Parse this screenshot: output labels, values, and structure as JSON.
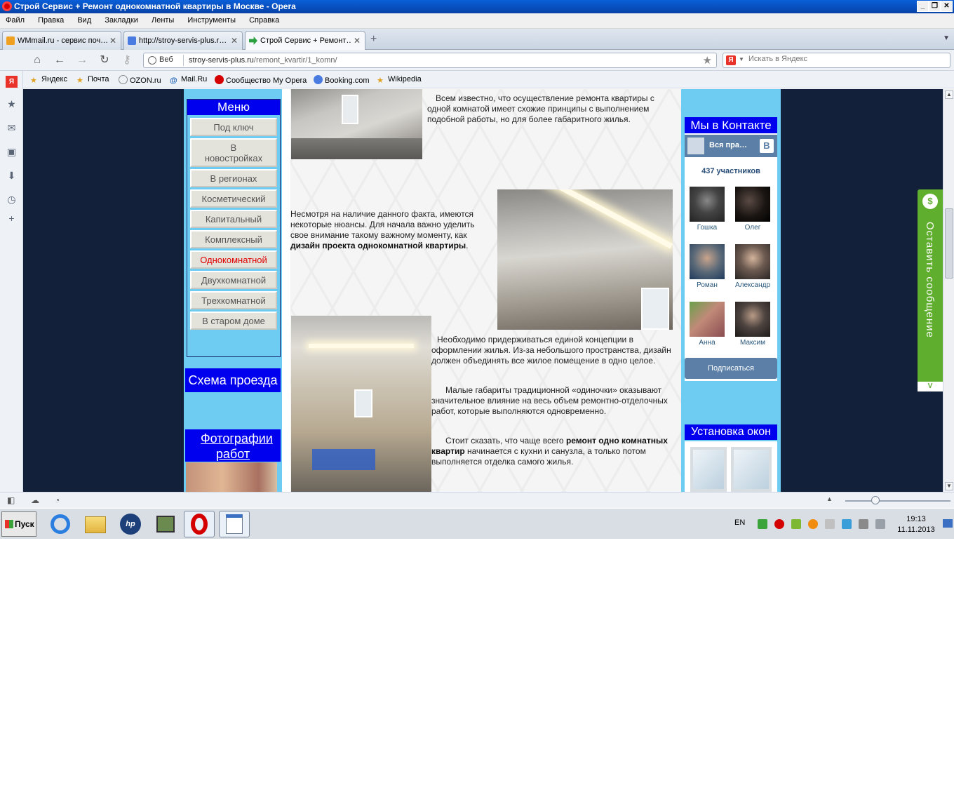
{
  "window": {
    "title": "Строй Сервис + Ремонт однокомнатной квартиры в Москве - Opera"
  },
  "menubar": [
    "Файл",
    "Правка",
    "Вид",
    "Закладки",
    "Ленты",
    "Инструменты",
    "Справка"
  ],
  "tabs": [
    {
      "label": "WMmail.ru - сервис поч…",
      "favicon_color": "#f0a020"
    },
    {
      "label": "http://stroy-servis-plus.r…",
      "favicon_color": "#4a7be0"
    },
    {
      "label": "Строй Сервис + Ремонт…",
      "favicon_color": "#2aa040"
    }
  ],
  "address": {
    "badge": "Веб",
    "host": "stroy-servis-plus.ru",
    "path": "/remont_kvartir/1_komn/"
  },
  "search": {
    "placeholder": "Искать в Яндекс"
  },
  "bookmarks": [
    "Яндекс",
    "Почта",
    "OZON.ru",
    "Mail.Ru",
    "Сообщество My Opera",
    "Booking.com",
    "Wikipedia"
  ],
  "site": {
    "menu_title": "Меню",
    "menu_items": [
      "Под ключ",
      "В новостройках",
      "В регионах",
      "Косметический",
      "Капитальный",
      "Комплексный",
      "Однокомнатной",
      "Двухкомнатной",
      "Трехкомнатной",
      "В старом доме"
    ],
    "menu_active": "Однокомнатной",
    "route_head": "Схема проезда",
    "photos_head": "Фотографии работ",
    "p1": "Всем известно, что осуществление  ремонта квартиры с одной комнатой имеет схожие принципы с выполнением подобной работы, но для более габаритного жилья.",
    "p2_text": "Несмотря на наличие данного факта, имеются некоторые нюансы. Для начала важно уделить свое внимание такому важному моменту, как",
    "p2_bold": "дизайн проекта однокомнатной квартиры",
    "p3": "Необходимо придерживаться единой концепции в оформлении жилья. Из-за небольшого пространства, дизайн  должен объединять все жилое помещение в одно целое.",
    "p4": "Малые габариты традиционной «одиночки» оказывают значительное влияние на весь объем ремонтно-отделочных работ, которые выполняются одновременно.",
    "p5_a": "Стоит сказать, что чаще всего",
    "p5_bold": "ремонт одно комнатных квартир",
    "p5_b": "начинается с кухни и санузла, а только потом выполняется отделка самого жилья."
  },
  "vk": {
    "head": "Мы в Контакте",
    "group": "Вся пра…",
    "logo": "В",
    "count": "437 участников",
    "members": [
      "Гошка",
      "Олег",
      "Роман",
      "Александр",
      "Анна",
      "Максим"
    ],
    "subscribe": "Подписаться"
  },
  "windows_head": "Установка окон",
  "feedback": {
    "label": "Оставить сообщение",
    "icon": "speech-icon"
  },
  "taskbar": {
    "start": "Пуск",
    "lang": "EN",
    "time": "19:13",
    "date": "11.11.2013"
  }
}
